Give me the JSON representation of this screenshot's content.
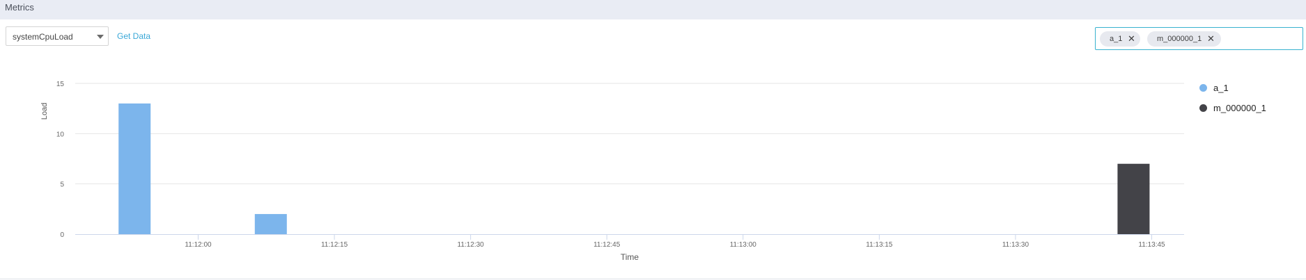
{
  "header": {
    "title": "Metrics"
  },
  "controls": {
    "metric_select_value": "systemCpuLoad",
    "get_data_label": "Get Data"
  },
  "node_filter": {
    "chips": [
      {
        "label": "a_1"
      },
      {
        "label": "m_000000_1"
      }
    ]
  },
  "colors": {
    "a_1": "#7cb5ec",
    "m_000000_1": "#434348",
    "accent": "#3aa8d8"
  },
  "chart_data": {
    "type": "bar",
    "xlabel": "Time",
    "ylabel": "Load",
    "ylim": [
      0,
      15
    ],
    "y_ticks": [
      "0",
      "5",
      "10",
      "15"
    ],
    "x_ticks": [
      "11:12:00",
      "11:12:15",
      "11:12:30",
      "11:12:45",
      "11:13:00",
      "11:13:15",
      "11:13:30",
      "11:13:45"
    ],
    "grid": true,
    "legend_position": "right",
    "series": [
      {
        "name": "a_1",
        "points": [
          {
            "x": "11:11:53",
            "y": 13
          },
          {
            "x": "11:12:08",
            "y": 2
          }
        ]
      },
      {
        "name": "m_000000_1",
        "points": [
          {
            "x": "11:13:43",
            "y": 7
          }
        ]
      }
    ]
  }
}
